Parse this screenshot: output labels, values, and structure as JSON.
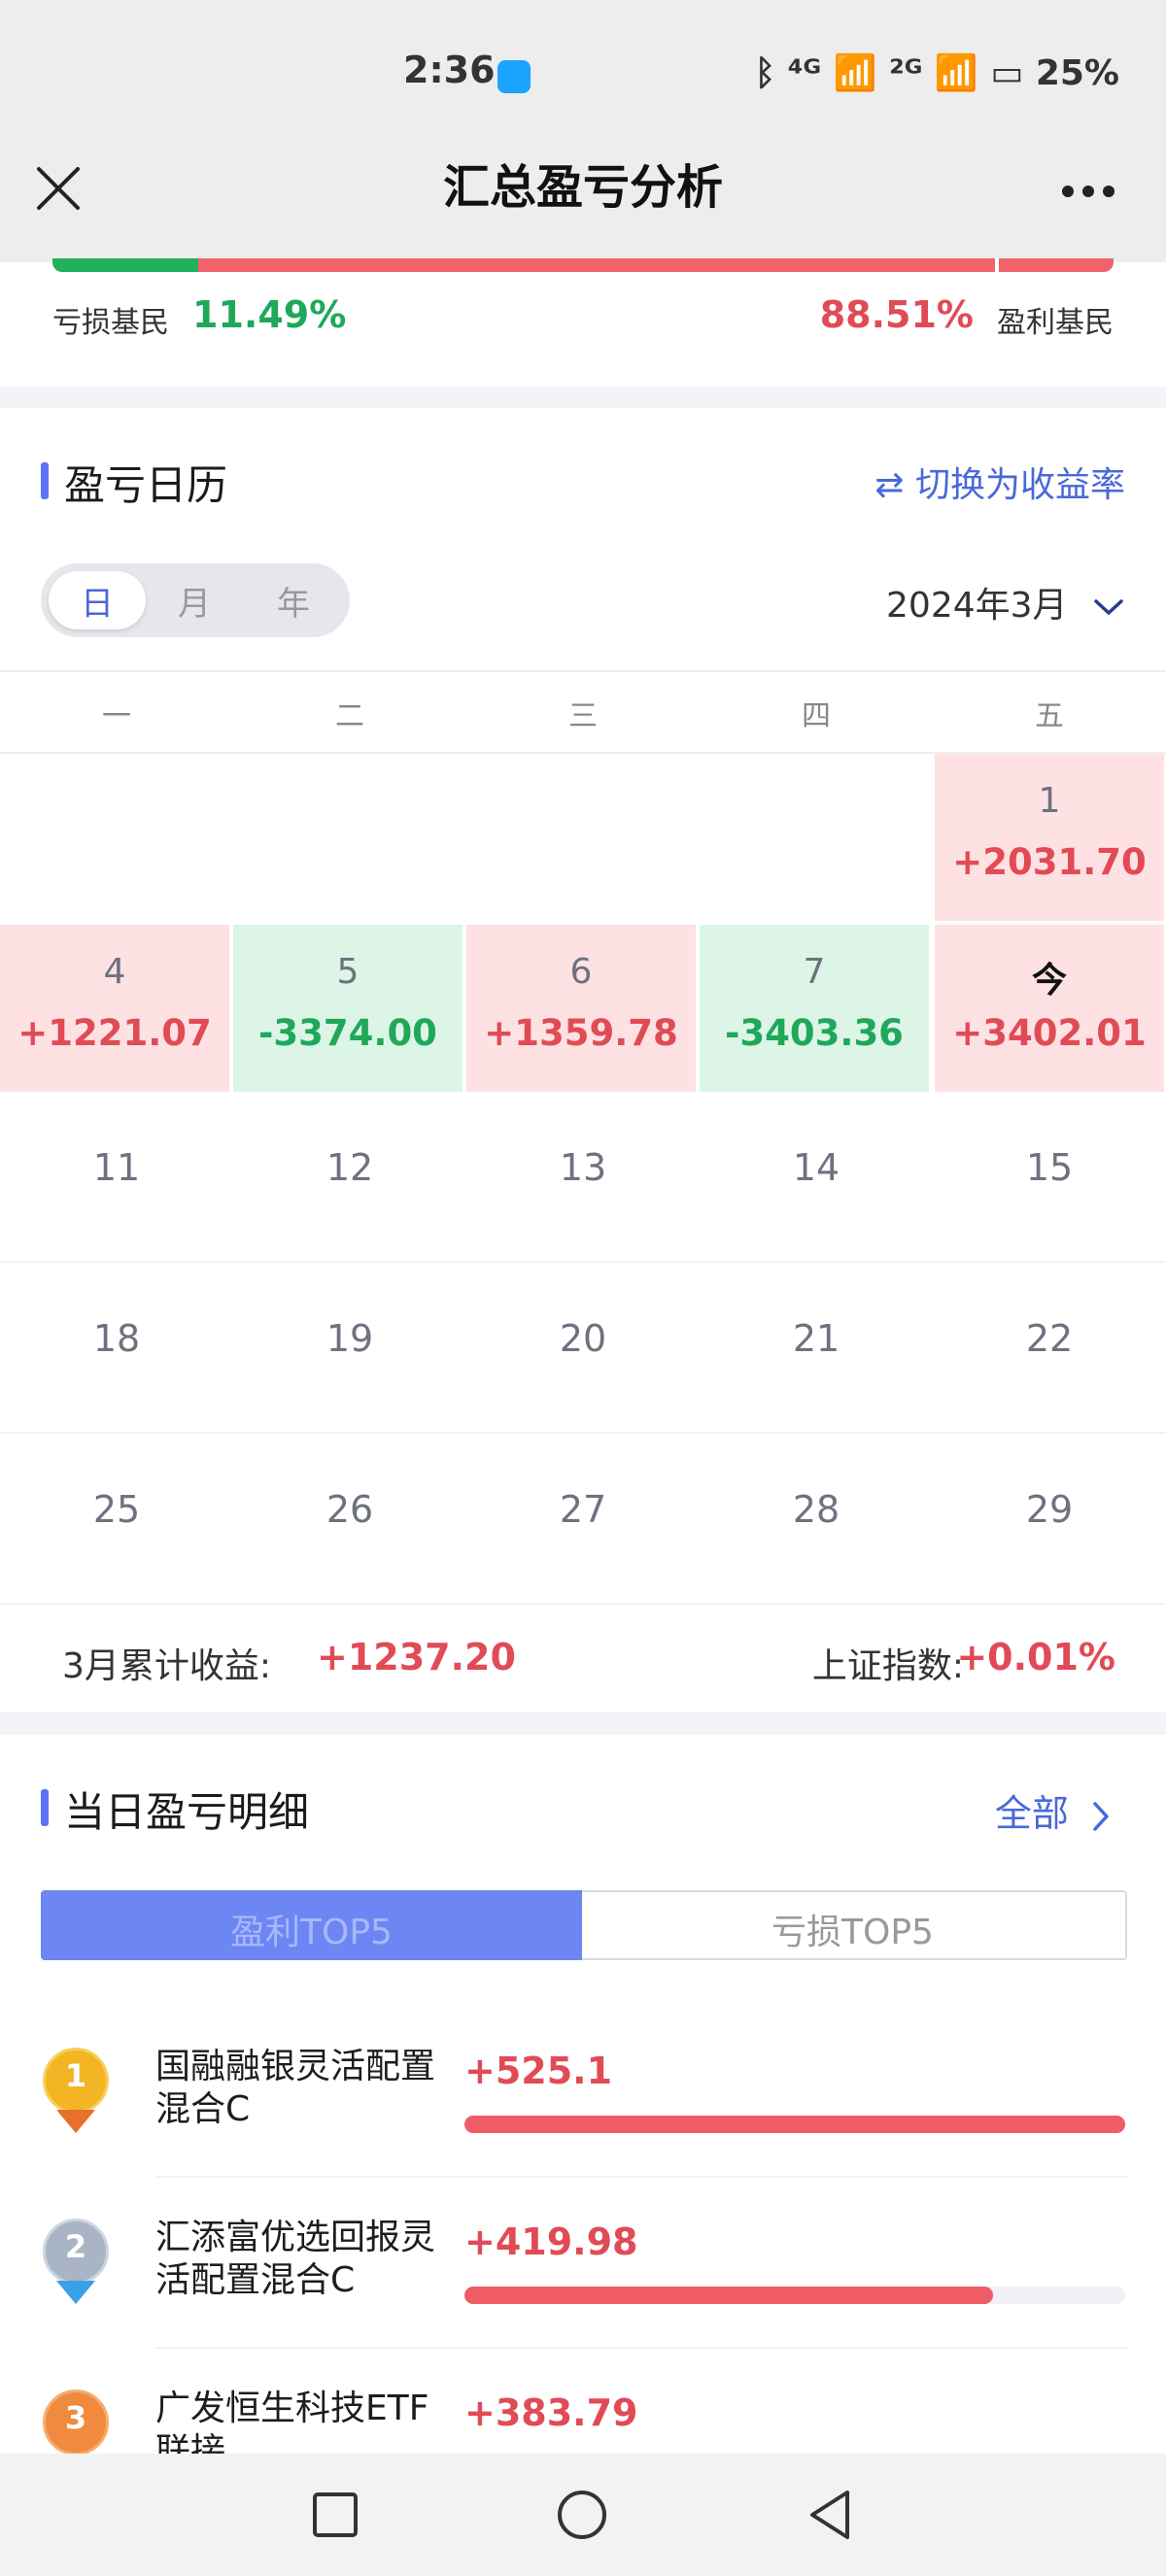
{
  "status_bar": {
    "time": "2:36",
    "right_text": "ᛒ ⁴ᴳ 📶 ²ᴳ 📶 ▭ 25%",
    "battery": "25%"
  },
  "header": {
    "title": "汇总盈亏分析"
  },
  "distribution": {
    "loss_label": "亏损基民",
    "loss_value": "11.49%",
    "profit_value": "88.51%",
    "profit_label": "盈利基民",
    "loss_fraction": 0.1149
  },
  "calendar": {
    "title": "盈亏日历",
    "switch_label": "⇄ 切换为收益率",
    "segments": [
      "日",
      "月",
      "年"
    ],
    "active_segment": "日",
    "month": "2024年3月",
    "weekdays": [
      "一",
      "二",
      "三",
      "四",
      "五"
    ],
    "first_row": {
      "date": "1",
      "value": "+2031.70"
    },
    "second_row": [
      {
        "date": "4",
        "value": "+1221.07"
      },
      {
        "date": "5",
        "value": "-3374.00"
      },
      {
        "date": "6",
        "value": "+1359.78"
      },
      {
        "date": "7",
        "value": "-3403.36"
      },
      {
        "date": "今",
        "value": "+3402.01"
      }
    ],
    "rows": [
      [
        "11",
        "12",
        "13",
        "14",
        "15"
      ],
      [
        "18",
        "19",
        "20",
        "21",
        "22"
      ],
      [
        "25",
        "26",
        "27",
        "28",
        "29"
      ]
    ],
    "cumulative_label": "3月累计收益:",
    "cumulative_value": "+1237.20",
    "index_label": "上证指数:",
    "index_value": "+0.01%"
  },
  "detail": {
    "title": "当日盈亏明细",
    "all_label": "全部",
    "tabs": [
      "盈利TOP5",
      "亏损TOP5"
    ],
    "items": [
      {
        "rank": "1",
        "name": "国融融银灵活配置混合C",
        "value": "+525.1",
        "fraction": 1.0
      },
      {
        "rank": "2",
        "name": "汇添富优选回报灵活配置混合C",
        "value": "+419.98",
        "fraction": 0.8
      },
      {
        "rank": "3",
        "name": "广发恒生科技ETF联接",
        "value": "+383.79",
        "fraction": 0.73
      }
    ]
  },
  "colors": {
    "profit": "#e04b55",
    "loss": "#1fa85a",
    "accent": "#5b72f5"
  },
  "icons": [
    "close-icon",
    "more-icon",
    "switch-icon",
    "chevron-down-icon",
    "chevron-right-icon",
    "nav-square-icon",
    "nav-home-icon",
    "nav-back-icon"
  ]
}
